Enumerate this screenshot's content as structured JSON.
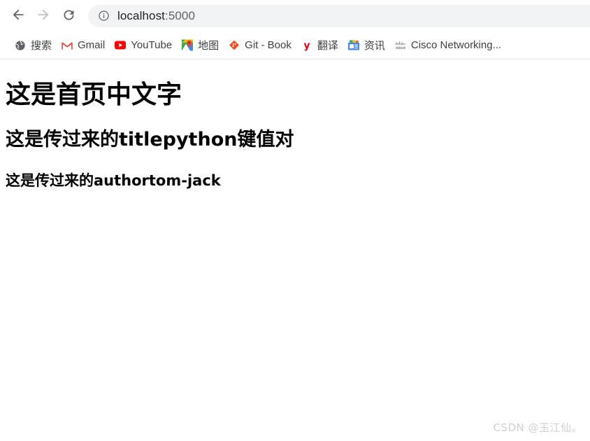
{
  "browser": {
    "nav": {
      "back_icon": "arrow-left-icon",
      "forward_icon": "arrow-right-icon",
      "reload_icon": "reload-icon"
    },
    "omnibox": {
      "security_icon": "info-circle-icon",
      "url_host": "localhost",
      "url_port": ":5000",
      "full_url": "localhost:5000"
    },
    "bookmarks": [
      {
        "label": "搜索",
        "icon": "globe-icon"
      },
      {
        "label": "Gmail",
        "icon": "gmail-icon"
      },
      {
        "label": "YouTube",
        "icon": "youtube-icon"
      },
      {
        "label": "地图",
        "icon": "google-maps-icon"
      },
      {
        "label": "Git - Book",
        "icon": "git-diamond-icon"
      },
      {
        "label": "翻译",
        "icon": "youdao-translate-icon"
      },
      {
        "label": "资讯",
        "icon": "news-icon"
      },
      {
        "label": "Cisco Networking...",
        "icon": "cisco-icon"
      }
    ]
  },
  "page": {
    "heading1": "这是首页中文字",
    "heading2": "这是传过来的titlepython键值对",
    "heading3": "这是传过来的authortom-jack"
  },
  "watermark": {
    "text": "CSDN @玉江仙。"
  },
  "colors": {
    "omnibox_bg": "#f1f3f4",
    "toolbar_bg": "#ffffff",
    "text_primary": "#202124",
    "text_secondary": "#5f6368",
    "bookmark_label": "#3c4043",
    "page_bg": "#ffffff",
    "watermark": "#cfcfcf"
  }
}
